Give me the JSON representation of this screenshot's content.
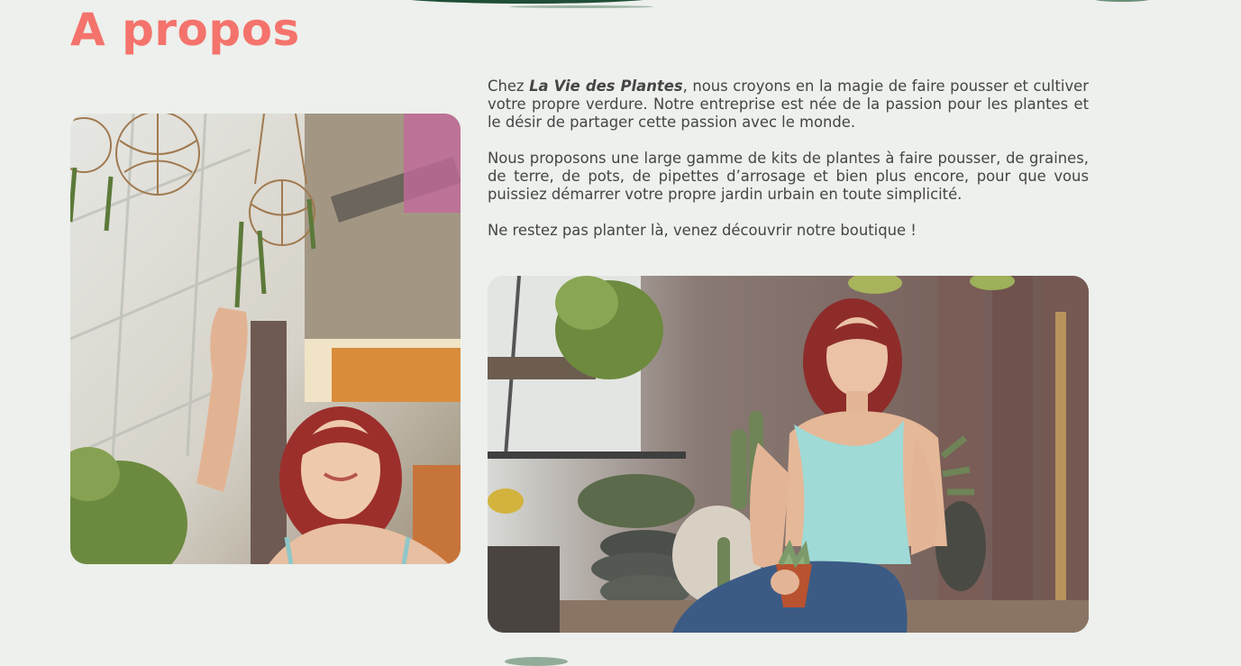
{
  "page": {
    "title": "A propos",
    "accent_color": "#f4736c",
    "background_color": "#edf0ec"
  },
  "about": {
    "p1_before": "Chez ",
    "brand": "La Vie des Plantes",
    "p1_after": ", nous croyons en la magie de faire pousser et cultiver votre propre verdure. Notre entreprise est née de la passion pour les plantes et le désir de partager cette passion avec le monde.",
    "p2": "Nous proposons une large gamme de kits de plantes à faire pousser, de graines, de terre, de pots, de pipettes d’arrosage et bien plus encore, pour que vous puissiez démarrer votre propre jardin urbain en toute simplicité.",
    "p3": "Ne restez pas planter là, venez découvrir notre boutique !"
  },
  "images": {
    "left_photo": "woman-reaching-hanging-plant-photo",
    "right_photo": "woman-sitting-with-succulent-photo"
  }
}
